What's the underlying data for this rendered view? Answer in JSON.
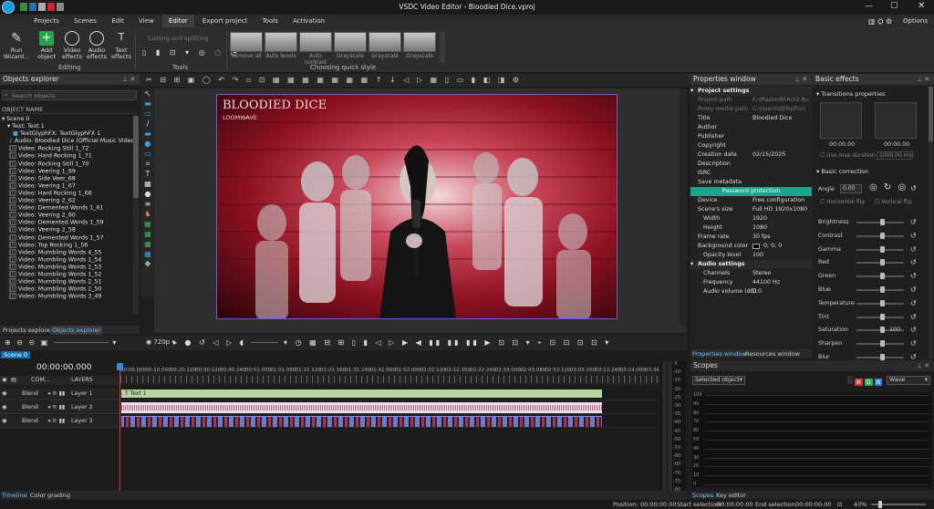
{
  "window": {
    "title": "VSDC Video Editor - Bloodied Dice.vproj",
    "options_label": "Options"
  },
  "menu": [
    "Projects",
    "Scenes",
    "Edit",
    "View",
    "Editor",
    "Export project",
    "Tools",
    "Activation"
  ],
  "ribbon": {
    "run_wizard": "Run Wizard...",
    "add_object": "Add object",
    "video_effects": "Video effects",
    "audio_effects": "Audio effects",
    "text_effects": "Text effects",
    "editing_label": "Editing",
    "cutting_label": "Cutting and splitting",
    "tools_label": "Tools",
    "quick_styles": [
      "Remove all",
      "Auto levels",
      "Auto contrast",
      "Grayscale",
      "Grayscale",
      "Grayscale"
    ],
    "quick_style_label": "Choosing quick style"
  },
  "objects_explorer": {
    "title": "Objects explorer",
    "search_placeholder": "Search objects",
    "column_header": "OBJECT NAME",
    "items": [
      "Scene 0",
      "Text: Text 1",
      "TextGlyphFX: TextGlyphFX 1",
      "Audio: Bloodied Dice (Official Music Video)...",
      "Video: Rocking Still 1_72",
      "Video: Hard Rocking 1_71",
      "Video: Rocking Still 1_70",
      "Video: Veering 1_69",
      "Video: Side Veer_68",
      "Video: Veering 1_67",
      "Video: Hard Rocking 1_66",
      "Video: Veering 2_62",
      "Video: Demented Words 1_61",
      "Video: Veering 2_60",
      "Video: Demented Words 1_59",
      "Video: Veering 2_58",
      "Video: Demented Words 1_57",
      "Video: Top Rocking 1_56",
      "Video: Mumbling Words 4_55",
      "Video: Mumbling Words 1_54",
      "Video: Mumbling Words 1_53",
      "Video: Mumbling Words 1_52",
      "Video: Mumbling Words 2_51",
      "Video: Mumbling Words 2_50",
      "Video: Mumbling Words 3_49"
    ],
    "tabs": [
      "Projects explorer",
      "Objects explorer"
    ]
  },
  "preview": {
    "title": "BLOODIED DICE",
    "subtitle": "LOOMWAVE",
    "zoom": "720p"
  },
  "properties": {
    "title": "Properties window",
    "rows": [
      {
        "k": "Project settings",
        "v": "",
        "sec": true
      },
      {
        "k": "Project path",
        "v": "E:\\MasterBFA\\02-Busine",
        "dim": true
      },
      {
        "k": "Proxy media path",
        "v": "C:\\Users\\djhkpfhv\\",
        "dim": true
      },
      {
        "k": "Title",
        "v": "Bloodied Dice"
      },
      {
        "k": "Author",
        "v": ""
      },
      {
        "k": "Publisher",
        "v": ""
      },
      {
        "k": "Copyright",
        "v": ""
      },
      {
        "k": "Creation date",
        "v": "02/15/2025"
      },
      {
        "k": "Description",
        "v": ""
      },
      {
        "k": "ISRC",
        "v": ""
      },
      {
        "k": "Save metadata",
        "v": ""
      },
      {
        "k": "Password protection",
        "v": "",
        "btn": true
      },
      {
        "k": "Device",
        "v": "Free configuration"
      },
      {
        "k": "Scene's size",
        "v": "Full HD 1920x1080 pixe"
      },
      {
        "k": "Width",
        "v": "1920",
        "ind": true
      },
      {
        "k": "Height",
        "v": "1080",
        "ind": true
      },
      {
        "k": "Frame rate",
        "v": "30 fps"
      },
      {
        "k": "Background color",
        "v": "0; 0; 0"
      },
      {
        "k": "Opacity level",
        "v": "100",
        "ind": true
      },
      {
        "k": "Audio settings",
        "v": "",
        "sec": true
      },
      {
        "k": "Channels",
        "v": "Stereo",
        "ind": true
      },
      {
        "k": "Frequency",
        "v": "44100 Hz",
        "ind": true
      },
      {
        "k": "Audio volume (dB)",
        "v": "0.0",
        "ind": true
      }
    ],
    "tabs": [
      "Properties window",
      "Resources window"
    ]
  },
  "basic_effects": {
    "title": "Basic effects",
    "transitions": "Transitions properties",
    "t1": "00:00.00",
    "t2": "00:00.00",
    "use_max": "Use max duration",
    "max_val": "1000.00 ms",
    "correction": "Basic correction",
    "angle": "Angle",
    "angle_val": "0.00",
    "hflip": "Horizontal flip",
    "vflip": "Vertical flip",
    "sliders": [
      {
        "n": "Brightness",
        "v": ""
      },
      {
        "n": "Contrast",
        "v": ""
      },
      {
        "n": "Gamma",
        "v": ""
      },
      {
        "n": "Red",
        "v": ""
      },
      {
        "n": "Green",
        "v": ""
      },
      {
        "n": "Blue",
        "v": ""
      },
      {
        "n": "Temperature",
        "v": ""
      },
      {
        "n": "Tint",
        "v": ""
      },
      {
        "n": "Saturation",
        "v": "100"
      },
      {
        "n": "Sharpen",
        "v": ""
      },
      {
        "n": "Blur",
        "v": ""
      }
    ]
  },
  "timeline": {
    "scene_tab": "Scene 0",
    "time": "00:00:00.000",
    "com_label": "COM...",
    "layers_label": "LAYERS",
    "ticks": [
      "00:00.000",
      "00:10.040",
      "00:20.120",
      "00:30.120",
      "00:40.240",
      "00:51.000",
      "01:01.080",
      "01:11.120",
      "01:21.160",
      "01:31.240",
      "01:42.000",
      "01:52.000",
      "02:02.120",
      "02:12.160",
      "02:22.240",
      "02:33.000",
      "02:43.080",
      "02:53.120",
      "03:03.160",
      "03:13.240",
      "03:24.000",
      "03:34.000"
    ],
    "layers": [
      {
        "blend": "Blend",
        "name": "Layer 1",
        "clip": "Text 1"
      },
      {
        "blend": "Blend",
        "name": "Layer 2",
        "clip": ""
      },
      {
        "blend": "Blend",
        "name": "Layer 3",
        "clip": ""
      }
    ],
    "meter_ticks": [
      "-5",
      "-10",
      "-15",
      "-20",
      "-25",
      "-30",
      "-35",
      "-40",
      "-45",
      "-50",
      "-55",
      "-60",
      "-65",
      "-70",
      "-75",
      "-80"
    ],
    "bottom_tabs": [
      "Timeline",
      "Color grading"
    ]
  },
  "scopes": {
    "title": "Scopes",
    "source": "Selected object",
    "mode": "Wave",
    "y_ticks": [
      "100",
      "90",
      "80",
      "70",
      "60",
      "50",
      "40",
      "30",
      "20",
      "10",
      "0"
    ],
    "tabs": [
      "Scopes",
      "Key editor"
    ]
  },
  "status": {
    "position_label": "Position:",
    "position": "00:00:00.00",
    "start_label": "Start selection:",
    "start": "00:00:00.00",
    "end_label": "End selection:",
    "end": "00:00:00.00",
    "zoom": "43%"
  },
  "colors": {
    "accent": "#1c9bd6",
    "active_menu": "#3d3d3d",
    "properties_accent": "#1aa48e",
    "clip_text": "#b9d4a3",
    "clip_audio": "#e9dfe7",
    "clip_video": "#6c7bc8"
  }
}
